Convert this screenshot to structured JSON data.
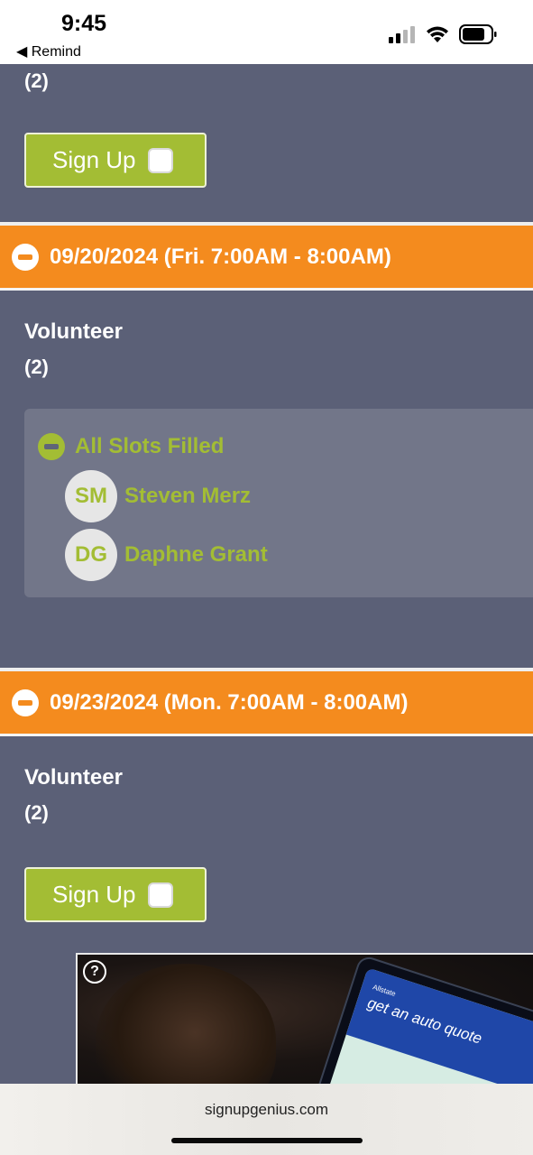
{
  "status_bar": {
    "time": "9:45",
    "back_label": "◀ Remind"
  },
  "sections": {
    "top": {
      "slot_count": "(2)",
      "signup_label": "Sign Up"
    },
    "friday": {
      "date_label": "09/20/2024 (Fri. 7:00AM - 8:00AM)",
      "role": "Volunteer",
      "slot_count": "(2)",
      "filled_label": "All Slots Filled",
      "volunteers": [
        {
          "initials": "SM",
          "name": "Steven Merz"
        },
        {
          "initials": "DG",
          "name": "Daphne Grant"
        }
      ]
    },
    "monday": {
      "date_label": "09/23/2024 (Mon. 7:00AM - 8:00AM)",
      "role": "Volunteer",
      "slot_count": "(2)",
      "signup_label": "Sign Up"
    }
  },
  "ad": {
    "help_label": "?",
    "brand": "Allstate",
    "headline": "get an auto quote"
  },
  "browser": {
    "domain": "signupgenius.com"
  },
  "colors": {
    "page_bg": "#5b6077",
    "date_bar": "#f48b1e",
    "accent_green": "#a3bd34",
    "filled_panel": "#727689"
  }
}
